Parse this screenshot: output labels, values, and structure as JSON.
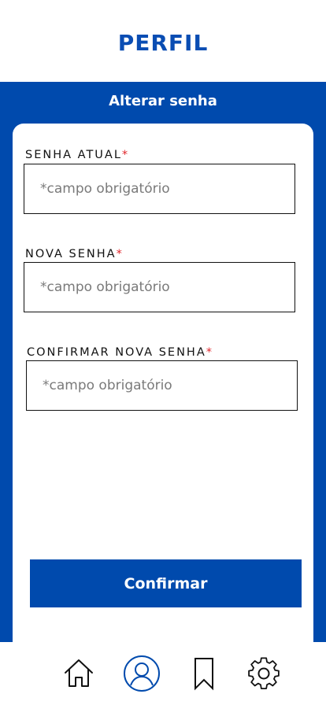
{
  "header": {
    "title": "PERFIL"
  },
  "section": {
    "title": "Alterar senha"
  },
  "form": {
    "required_marker": "*",
    "fields": [
      {
        "label": "SENHA ATUAL",
        "placeholder": "*campo obrigatório"
      },
      {
        "label": "NOVA SENHA",
        "placeholder": "*campo obrigatório"
      },
      {
        "label": "CONFIRMAR NOVA SENHA",
        "placeholder": "*campo obrigatório"
      }
    ],
    "confirm_label": "Confirmar"
  },
  "nav": {
    "items": [
      "home-icon",
      "profile-icon",
      "bookmark-icon",
      "settings-icon"
    ],
    "active": "profile-icon"
  },
  "colors": {
    "brand_blue": "#004aad",
    "title_blue": "#0a4db3",
    "required_red": "#e0262b"
  }
}
